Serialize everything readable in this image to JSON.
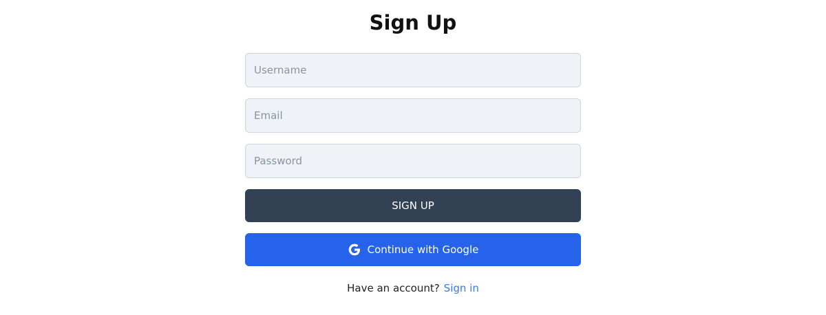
{
  "header": {
    "title": "Sign Up"
  },
  "form": {
    "username_placeholder": "Username",
    "email_placeholder": "Email",
    "password_placeholder": "Password",
    "signup_label": "SIGN UP",
    "google_label": "Continue with Google"
  },
  "footer": {
    "prompt": "Have an account?",
    "signin_link": "Sign in"
  },
  "colors": {
    "signup_button": "#334155",
    "google_button": "#2563eb",
    "field_background": "#eff3f8",
    "link": "#3b78e7"
  },
  "icons": {
    "google": "google-icon"
  }
}
